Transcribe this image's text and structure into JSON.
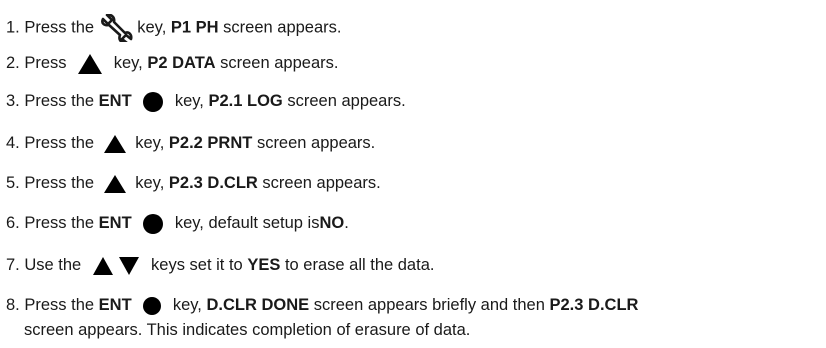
{
  "steps": [
    {
      "num": "1.",
      "parts": [
        "Press the",
        "key,",
        "P1 PH",
        "screen appears."
      ]
    },
    {
      "num": "2.",
      "parts": [
        "Press",
        "key,",
        "P2 DATA",
        "screen appears."
      ]
    },
    {
      "num": "3.",
      "parts": [
        "Press the",
        "ENT",
        "key,",
        "P2.1 LOG",
        "screen appears."
      ]
    },
    {
      "num": "4.",
      "parts": [
        "Press the",
        "key,",
        "P2.2 PRNT",
        "screen appears."
      ]
    },
    {
      "num": "5.",
      "parts": [
        "Press the",
        "key,",
        "P2.3 D.CLR",
        "screen appears."
      ]
    },
    {
      "num": "6.",
      "parts": [
        "Press the",
        "ENT",
        "key, default setup is",
        "NO",
        "."
      ]
    },
    {
      "num": "7.",
      "parts": [
        "Use the",
        "keys set it to",
        "YES",
        "to erase all the data."
      ]
    },
    {
      "num": "8.",
      "parts": [
        "Press the",
        "ENT",
        "key,",
        "D.CLR DONE",
        "screen appears briefly and then",
        "P2.3 D.CLR",
        "screen appears. This indicates completion of erasure of data."
      ]
    }
  ],
  "icons": {
    "wrench": "wrench-icon",
    "up": "up-triangle-icon",
    "down": "down-triangle-icon",
    "enter": "enter-circle-icon"
  }
}
